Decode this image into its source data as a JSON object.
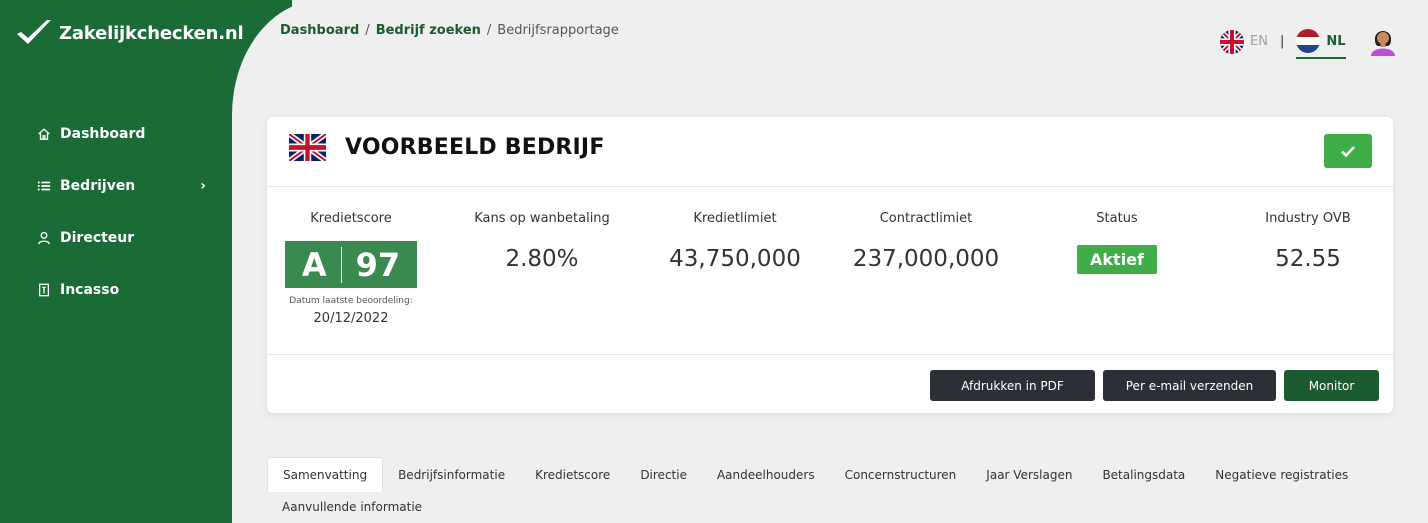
{
  "brand": {
    "name": "Zakelijkchecken.nl"
  },
  "sidebar": {
    "items": [
      {
        "label": "Dashboard",
        "icon": "home-icon"
      },
      {
        "label": "Bedrijven",
        "icon": "list-icon",
        "has_submenu": true
      },
      {
        "label": "Directeur",
        "icon": "user-icon"
      },
      {
        "label": "Incasso",
        "icon": "document-icon"
      }
    ]
  },
  "breadcrumb": {
    "item1": "Dashboard",
    "item2": "Bedrijf zoeken",
    "current": "Bedrijfsrapportage",
    "sep": "/"
  },
  "lang": {
    "en": "EN",
    "nl": "NL",
    "separator": "|",
    "active": "NL"
  },
  "company": {
    "name": "VOORBEELD BEDRIJF",
    "flag": "uk-flag"
  },
  "metrics": {
    "kredietscore": {
      "label": "Kredietscore",
      "grade": "A",
      "score": "97",
      "date_label": "Datum laatste beoordeling:",
      "date": "20/12/2022"
    },
    "wanbetaling": {
      "label": "Kans op wanbetaling",
      "value": "2.80%"
    },
    "kredietlimiet": {
      "label": "Kredietlimiet",
      "value": "43,750,000"
    },
    "contractlimiet": {
      "label": "Contractlimiet",
      "value": "237,000,000"
    },
    "status": {
      "label": "Status",
      "value": "Aktief"
    },
    "industry": {
      "label": "Industry OVB",
      "value": "52.55"
    }
  },
  "actions": {
    "pdf": "Afdrukken in PDF",
    "email": "Per e-mail verzenden",
    "monitor": "Monitor"
  },
  "tabs": {
    "row1": [
      "Samenvatting",
      "Bedrijfsinformatie",
      "Kredietscore",
      "Directie",
      "Aandeelhouders",
      "Concernstructuren",
      "Jaar Verslagen",
      "Betalingsdata",
      "Negatieve registraties"
    ],
    "row2": [
      "Aanvullende informatie"
    ],
    "active": "Samenvatting"
  },
  "colors": {
    "sidebar": "#1a6b36",
    "accent_green": "#3fae49",
    "score_green": "#3a8a4f",
    "dark_button": "#2d2f36",
    "monitor_button": "#1a5c30"
  }
}
